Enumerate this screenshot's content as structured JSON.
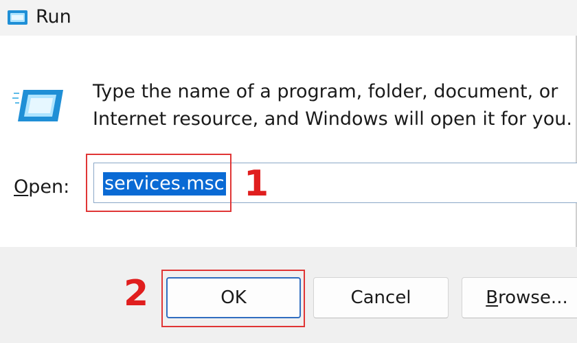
{
  "window": {
    "title": "Run",
    "icon": "run-app-icon"
  },
  "dialog": {
    "description": "Type the name of a program, folder, document, or Internet resource, and Windows will open it for you.",
    "open_label_key": "O",
    "open_label_rest": "pen:",
    "open_value": "services.msc"
  },
  "buttons": {
    "ok": "OK",
    "cancel": "Cancel",
    "browse_key": "B",
    "browse_rest": "rowse..."
  },
  "annotations": {
    "step1": "1",
    "step2": "2",
    "color": "#e01e1e"
  },
  "colors": {
    "selection": "#0a6ad4",
    "titlebar": "#f3f3f3",
    "footer": "#f0f0f0"
  }
}
